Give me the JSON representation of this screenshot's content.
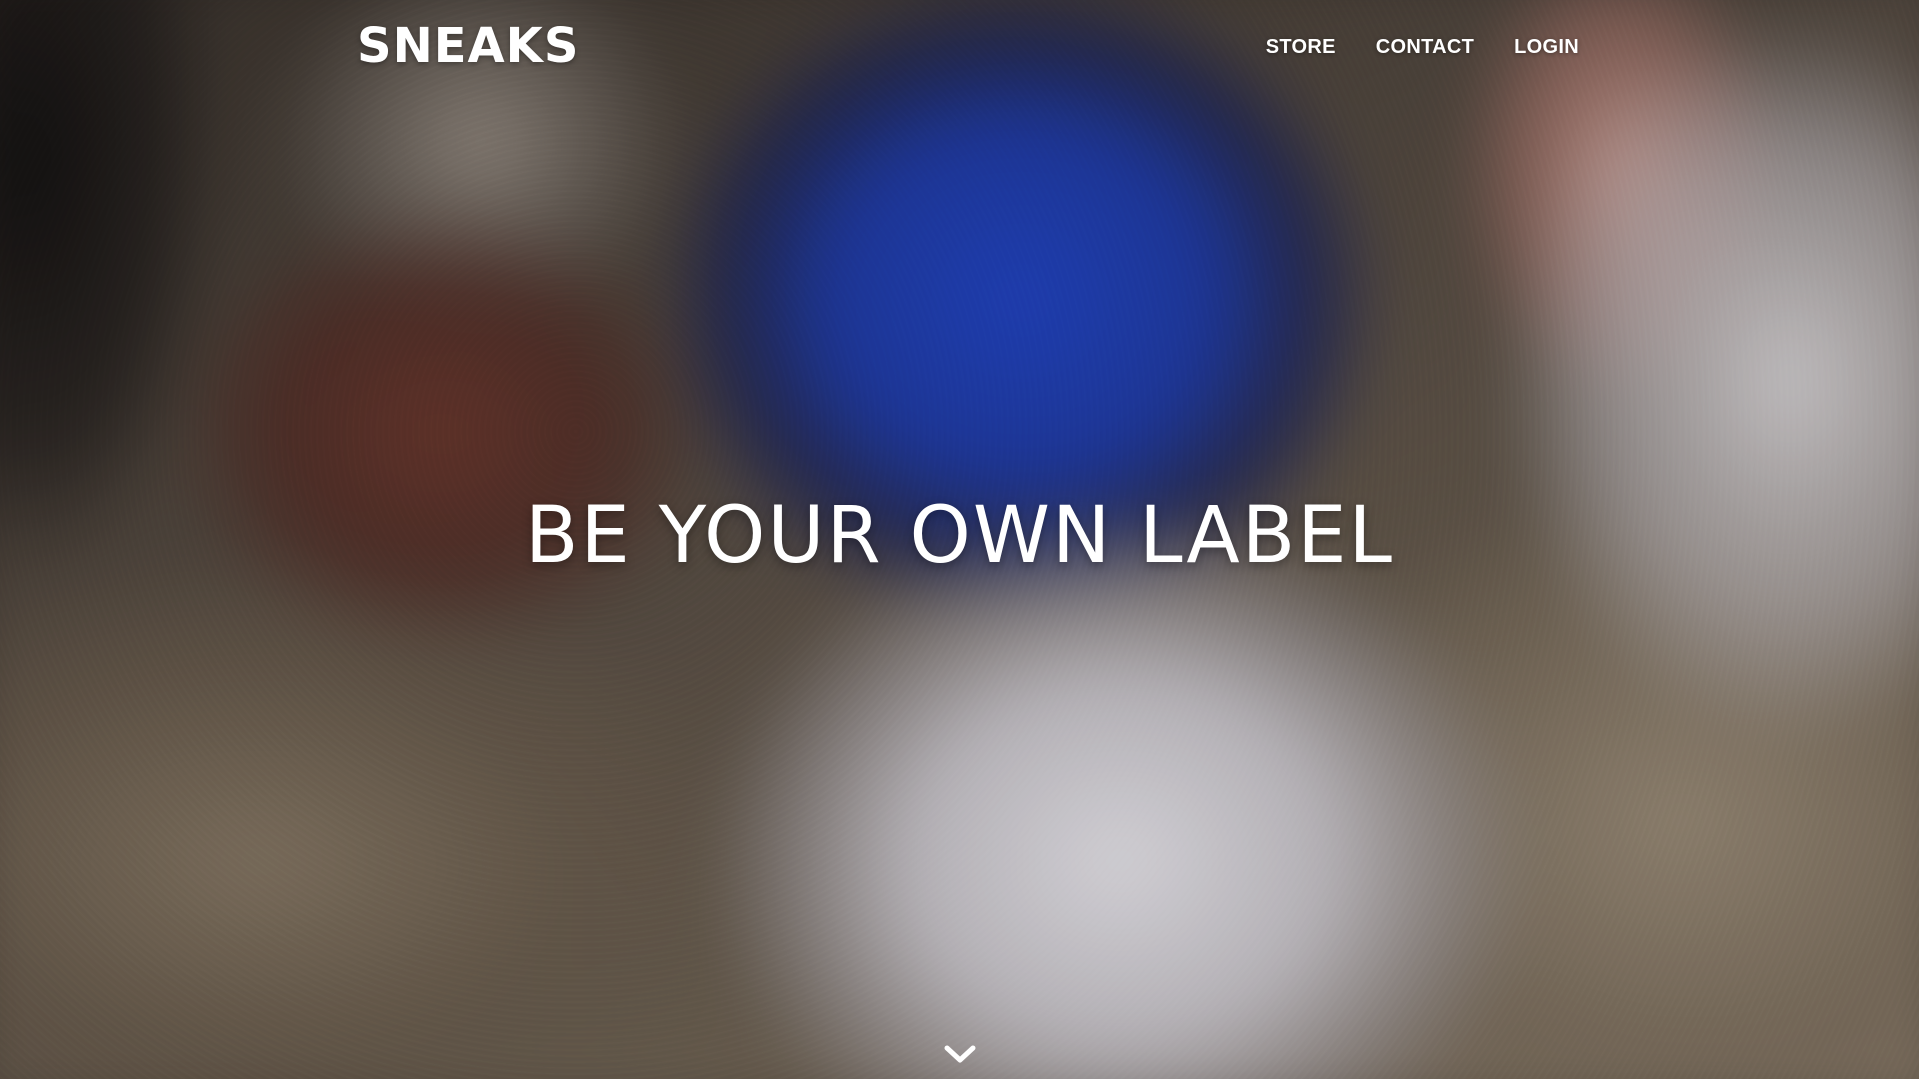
{
  "brand": {
    "logo_text": "SNEAKS"
  },
  "nav": {
    "items": [
      {
        "label": "STORE"
      },
      {
        "label": "CONTACT"
      },
      {
        "label": "LOGIN"
      }
    ]
  },
  "hero": {
    "headline": "BE YOUR OWN LABEL",
    "scroll_icon": "chevron-down-icon",
    "text_color": "#ffffff"
  }
}
